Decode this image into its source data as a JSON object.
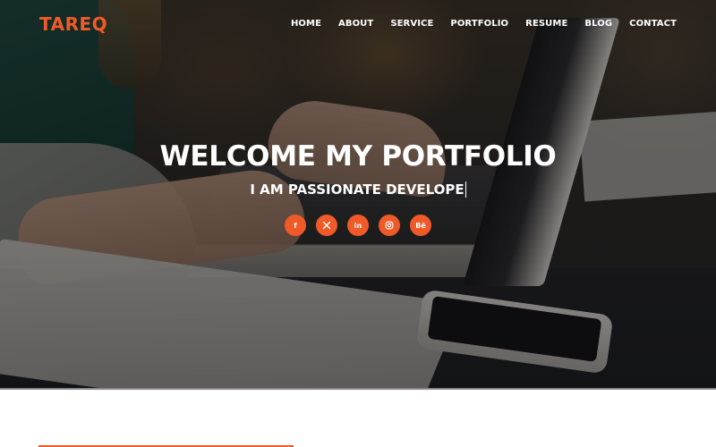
{
  "colors": {
    "accent": "#f05a28",
    "text_light": "#ffffff",
    "page_background": "#ffffff"
  },
  "header": {
    "logo": "TAREQ",
    "nav": [
      {
        "label": "HOME"
      },
      {
        "label": "ABOUT"
      },
      {
        "label": "SERVICE"
      },
      {
        "label": "PORTFOLIO"
      },
      {
        "label": "RESUME"
      },
      {
        "label": "BLOG"
      },
      {
        "label": "CONTACT"
      }
    ]
  },
  "hero": {
    "background": "photo of person typing on a laptop with notebook and phone on desk",
    "title": "WELCOME MY PORTFOLIO",
    "subtitle": "I AM PASSIONATE DEVELOPE",
    "socials": [
      {
        "name": "facebook",
        "icon": "facebook-icon",
        "glyph": "f"
      },
      {
        "name": "x",
        "icon": "x-icon",
        "glyph": "X"
      },
      {
        "name": "linkedin",
        "icon": "linkedin-icon",
        "glyph": "in"
      },
      {
        "name": "instagram",
        "icon": "instagram-icon",
        "glyph": ""
      },
      {
        "name": "behance",
        "icon": "behance-icon",
        "glyph": "Bē"
      }
    ]
  }
}
